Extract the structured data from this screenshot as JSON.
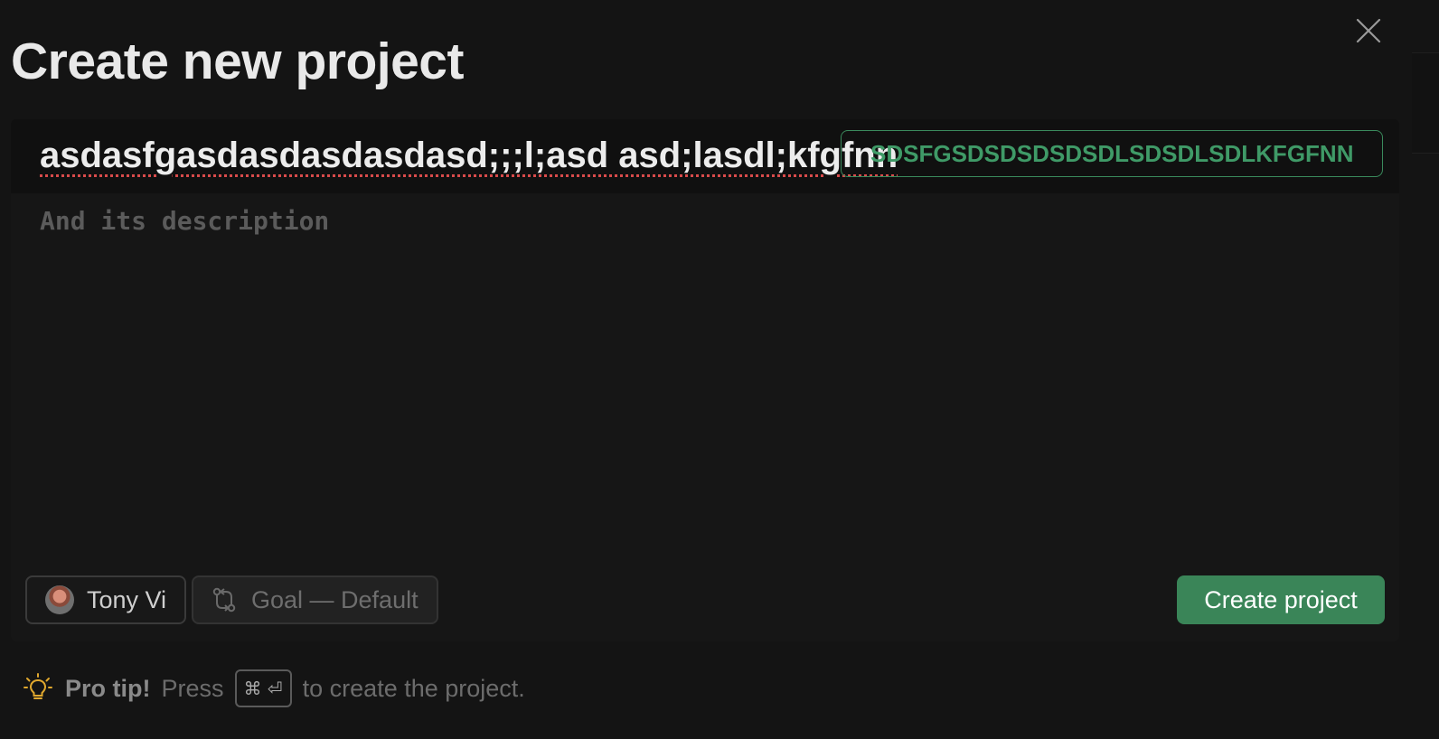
{
  "modal": {
    "title": "Create new project",
    "close_icon": "close-icon"
  },
  "form": {
    "title_value": "asdasfgasdasdasdasdasd;;;l;asd asd;lasdl;kfgfnn",
    "key_value": "SDSFGSDSDSDSDSDLSDSDLSDLKFGFNN",
    "description_placeholder": "And its description"
  },
  "owner": {
    "name": "Tony Vi",
    "icon": "avatar"
  },
  "flow": {
    "label": "Goal — Default",
    "icon": "flow-icon"
  },
  "actions": {
    "create_label": "Create project"
  },
  "tip": {
    "icon": "lightbulb-icon",
    "strong": "Pro tip!",
    "pre": "Press",
    "shortcut": "⌘ ⏎",
    "post": "to create the project."
  },
  "colors": {
    "background": "#141414",
    "accent": "#3a8558",
    "key_border": "#3a8a5c",
    "spellcheck": "#d94b4b",
    "tip_icon": "#e0a82e"
  }
}
